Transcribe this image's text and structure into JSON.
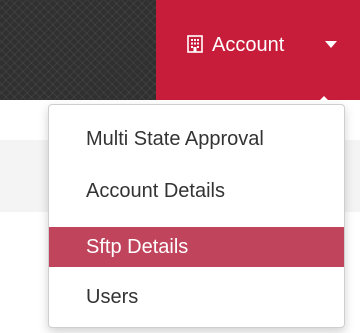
{
  "navbar": {
    "account_menu": {
      "label": "Account",
      "icon": "building-icon",
      "caret": "caret-down-icon",
      "accent_color": "#c71c3a"
    }
  },
  "dropdown": {
    "items": [
      {
        "label": "Multi State Approval",
        "active": false
      },
      {
        "label": "Account Details",
        "active": false
      },
      {
        "label": "Sftp Details",
        "active": true
      },
      {
        "label": "Users",
        "active": false
      }
    ],
    "active_color": "#c1445d"
  }
}
